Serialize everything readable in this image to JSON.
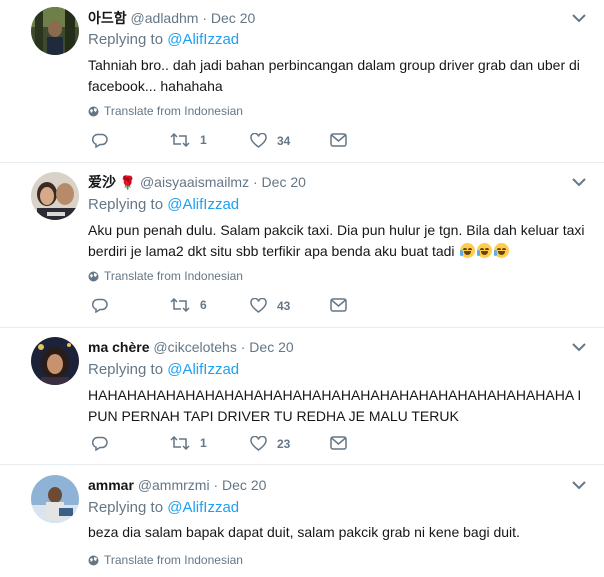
{
  "replies": [
    {
      "display_name": "아드함",
      "handle": "@adladhm",
      "date": "Dec 20",
      "replying_prefix": "Replying to",
      "replying_to": "@AlifIzzad",
      "text": "Tahniah bro.. dah jadi bahan perbincangan dalam group driver grab dan uber di facebook... hahahaha",
      "translate": "Translate from Indonesian",
      "retweets": "1",
      "likes": "34",
      "replies_count": ""
    },
    {
      "display_name": "爱沙",
      "handle": "@aisyaaismailmz",
      "date": "Dec 20",
      "replying_prefix": "Replying to",
      "replying_to": "@AlifIzzad",
      "text": "Aku pun penah dulu. Salam pakcik taxi. Dia pun hulur je tgn. Bila dah keluar taxi berdiri je lama2 dkt situ sbb terfikir apa benda aku buat tadi",
      "translate": "Translate from Indonesian",
      "retweets": "6",
      "likes": "43",
      "replies_count": ""
    },
    {
      "display_name": "ma chère",
      "handle": "@cikcelotehs",
      "date": "Dec 20",
      "replying_prefix": "Replying to",
      "replying_to": "@AlifIzzad",
      "text": "HAHAHAHAHAHAHAHAHAHAHAHAHAHAHAHAHAHAHAHAHAHAHAHAHA I PUN PERNAH TAPI DRIVER TU REDHA JE MALU TERUK",
      "retweets": "1",
      "likes": "23",
      "replies_count": ""
    },
    {
      "display_name": "ammar",
      "handle": "@ammrzmi",
      "date": "Dec 20",
      "replying_prefix": "Replying to",
      "replying_to": "@AlifIzzad",
      "text": "beza dia salam bapak dapat duit, salam pakcik grab ni kene bagi duit.",
      "translate": "Translate from Indonesian"
    }
  ],
  "icons": {
    "reply": "reply-icon",
    "retweet": "retweet-icon",
    "like": "heart-icon",
    "dm": "envelope-icon",
    "globe": "globe-icon",
    "menu": "chevron-down-icon",
    "emoji": "face-with-tears-of-joy-emoji"
  },
  "colors": {
    "link": "#1da1f2",
    "muted": "#657786",
    "text": "#14171a",
    "divider": "#e6ecf0"
  }
}
